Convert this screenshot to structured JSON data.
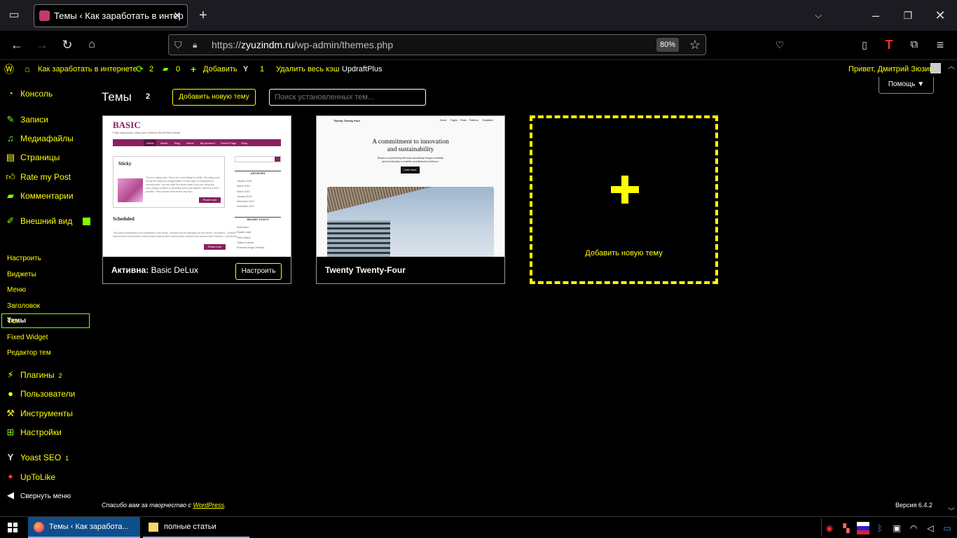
{
  "browser": {
    "tab_title": "Темы ‹ Как заработать в интер",
    "url_domain": "zyuzindm.ru",
    "url_path": "/wp-admin/themes.php",
    "url_scheme": "https://",
    "zoom": "80%"
  },
  "adminbar": {
    "site_name": "Как заработать в интернете",
    "updates_count": "2",
    "comments_count": "0",
    "add_label": "Добавить",
    "yoast_count": "1",
    "clear_cache": "Удалить весь кэш",
    "updraft": "UpdraftPlus",
    "greeting": "Привет, Дмитрий Зюзин"
  },
  "sidebar": {
    "items": [
      {
        "label": "Консоль",
        "icon": "dashboard-icon"
      },
      {
        "label": "Записи",
        "icon": "pin-icon"
      },
      {
        "label": "Медиафайлы",
        "icon": "media-icon"
      },
      {
        "label": "Страницы",
        "icon": "pages-icon"
      },
      {
        "label": "Rate my Post",
        "icon": "thumbs-up-icon"
      },
      {
        "label": "Комментарии",
        "icon": "comment-icon"
      },
      {
        "label": "Внешний вид",
        "icon": "brush-icon"
      },
      {
        "label": "Плагины",
        "icon": "plug-icon",
        "badge": "2"
      },
      {
        "label": "Пользователи",
        "icon": "user-icon"
      },
      {
        "label": "Инструменты",
        "icon": "wrench-icon"
      },
      {
        "label": "Настройки",
        "icon": "settings-icon"
      },
      {
        "label": "Yoast SEO",
        "icon": "yoast-icon",
        "badge": "1"
      },
      {
        "label": "UpToLike",
        "icon": "uptolike-icon"
      },
      {
        "label": "Свернуть меню",
        "icon": "collapse-icon"
      }
    ],
    "appearance_sub": [
      "Темы",
      "Настроить",
      "Виджеты",
      "Меню",
      "Заголовок",
      "Фон",
      "Fixed Widget",
      "Редактор тем"
    ]
  },
  "main": {
    "title": "Темы",
    "count": "2",
    "add_new": "Добавить новую тему",
    "search_placeholder": "Поиск установленных тем...",
    "help": "Помощь",
    "themes": [
      {
        "active_prefix": "Активна:",
        "name": "Basic DeLux",
        "action": "Настроить"
      },
      {
        "name": "Twenty Twenty-Four"
      }
    ],
    "add_tile_label": "Добавить новую тему"
  },
  "preview_basic": {
    "brand": "BASIC",
    "tagline": "Fully responsive, clean and minimal WordPress theme",
    "nav": [
      "Home",
      "About",
      "Blog",
      "Home",
      "My Account",
      "Parent Page",
      "Shop"
    ],
    "post_title": "Sticky",
    "post_text": "This is a sticky post. There are a few things to verify: The sticky post should be distinctly recognizable in some way in comparison to normal posts. You can style the sticky class if you are using the post_class() function to generate your post classes, which is a best practice. They should show at the very top…",
    "read_more": "Read more",
    "post2_title": "Scheduled",
    "post2_text": "This post is scheduled to be published in the future. It should not be displayed by the theme. Uncolored – Ordered ordered item ordered item ordered item ordered item ordered item ordered item ordered item Ordered – Uncolored …",
    "archives_head": "ARCHIVES",
    "archives": [
      "January 2000",
      "March 2015",
      "March 2013",
      "January 2013",
      "December 2012",
      "November 2012"
    ],
    "recent_head": "RECENT POSTS",
    "recent": [
      "Scheduled",
      "Привет, мир!",
      "Tiled Gallery",
      "Twitter Embeds",
      "Featured Image (Vertical)"
    ]
  },
  "preview_tt4": {
    "site": "Twenty Twenty Four",
    "nav": [
      "Home",
      "Pages",
      "Posts",
      "Patterns",
      "Templates"
    ],
    "headline1": "A commitment to innovation",
    "headline2": "and sustainability",
    "sub": "Études is a pioneering firm that seamlessly merges creativity and functionality to redefine architectural excellence.",
    "button": "Learn more"
  },
  "footer": {
    "thanks": "Спасибо вам за творчество с ",
    "wp_link": "WordPress",
    "thanks_end": ".",
    "version": "Версия 6.4.2"
  },
  "taskbar": {
    "firefox_task": "Темы ‹ Как заработа...",
    "folder_task": "полные статьи"
  },
  "colors": {
    "accent": "#ffff00",
    "icon": "#7fff00",
    "bg": "#000000"
  }
}
